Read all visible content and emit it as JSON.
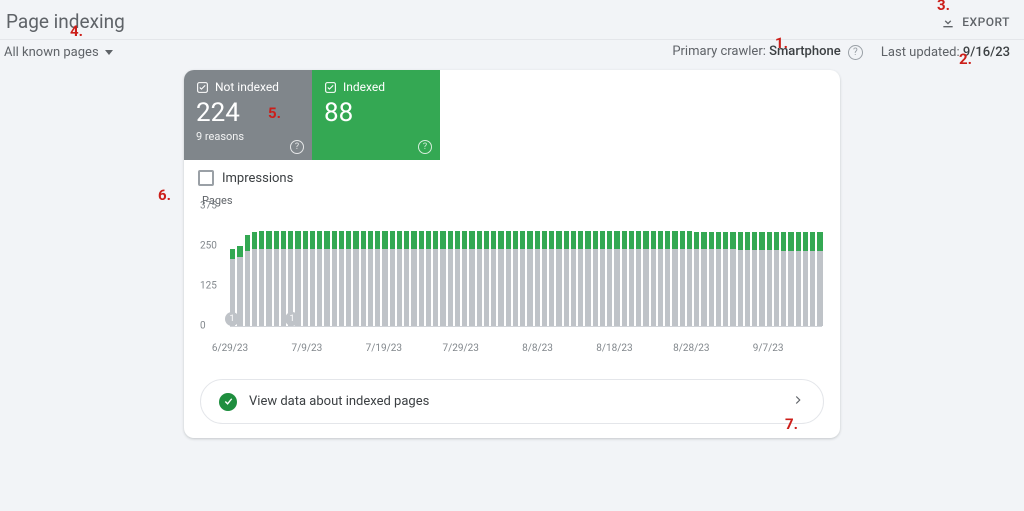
{
  "header": {
    "title": "Page indexing",
    "export_label": "EXPORT"
  },
  "filter": {
    "scope_label": "All known pages",
    "primary_crawler_label": "Primary crawler:",
    "primary_crawler_value": "Smartphone",
    "last_updated_label": "Last updated:",
    "last_updated_value": "9/16/23"
  },
  "status": {
    "not_indexed": {
      "label": "Not indexed",
      "count": "224",
      "subtext": "9 reasons"
    },
    "indexed": {
      "label": "Indexed",
      "count": "88"
    }
  },
  "impressions": {
    "label": "Impressions",
    "checked": false
  },
  "cta": {
    "text": "View data about indexed pages"
  },
  "annotations": [
    "1.",
    "2.",
    "3.",
    "4.",
    "5.",
    "6.",
    "7."
  ],
  "chart_data": {
    "type": "bar",
    "ylabel": "Pages",
    "yticks": [
      0,
      125,
      250,
      375
    ],
    "ylim": [
      0,
      375
    ],
    "x_labels": [
      "6/29/23",
      "7/9/23",
      "7/19/23",
      "7/29/23",
      "8/8/23",
      "8/18/23",
      "8/28/23",
      "9/7/23"
    ],
    "series": [
      {
        "name": "Not indexed",
        "color": "#bfc3c8"
      },
      {
        "name": "Indexed",
        "color": "#34a853"
      }
    ],
    "event_markers": [
      {
        "label": "1",
        "approx_date": "7/1/23"
      },
      {
        "label": "1",
        "approx_date": "7/9/23"
      }
    ],
    "bars": [
      {
        "not_indexed": 210,
        "indexed": 30
      },
      {
        "not_indexed": 215,
        "indexed": 35
      },
      {
        "not_indexed": 235,
        "indexed": 48
      },
      {
        "not_indexed": 240,
        "indexed": 55
      },
      {
        "not_indexed": 240,
        "indexed": 56
      },
      {
        "not_indexed": 240,
        "indexed": 56
      },
      {
        "not_indexed": 240,
        "indexed": 56
      },
      {
        "not_indexed": 240,
        "indexed": 56
      },
      {
        "not_indexed": 240,
        "indexed": 56
      },
      {
        "not_indexed": 240,
        "indexed": 56
      },
      {
        "not_indexed": 240,
        "indexed": 56
      },
      {
        "not_indexed": 240,
        "indexed": 56
      },
      {
        "not_indexed": 240,
        "indexed": 56
      },
      {
        "not_indexed": 240,
        "indexed": 56
      },
      {
        "not_indexed": 240,
        "indexed": 56
      },
      {
        "not_indexed": 240,
        "indexed": 56
      },
      {
        "not_indexed": 240,
        "indexed": 56
      },
      {
        "not_indexed": 240,
        "indexed": 56
      },
      {
        "not_indexed": 240,
        "indexed": 56
      },
      {
        "not_indexed": 240,
        "indexed": 56
      },
      {
        "not_indexed": 240,
        "indexed": 56
      },
      {
        "not_indexed": 240,
        "indexed": 56
      },
      {
        "not_indexed": 240,
        "indexed": 56
      },
      {
        "not_indexed": 240,
        "indexed": 56
      },
      {
        "not_indexed": 240,
        "indexed": 56
      },
      {
        "not_indexed": 240,
        "indexed": 56
      },
      {
        "not_indexed": 240,
        "indexed": 56
      },
      {
        "not_indexed": 240,
        "indexed": 56
      },
      {
        "not_indexed": 240,
        "indexed": 56
      },
      {
        "not_indexed": 240,
        "indexed": 56
      },
      {
        "not_indexed": 240,
        "indexed": 56
      },
      {
        "not_indexed": 240,
        "indexed": 56
      },
      {
        "not_indexed": 240,
        "indexed": 56
      },
      {
        "not_indexed": 240,
        "indexed": 56
      },
      {
        "not_indexed": 240,
        "indexed": 56
      },
      {
        "not_indexed": 240,
        "indexed": 56
      },
      {
        "not_indexed": 240,
        "indexed": 56
      },
      {
        "not_indexed": 240,
        "indexed": 56
      },
      {
        "not_indexed": 240,
        "indexed": 56
      },
      {
        "not_indexed": 240,
        "indexed": 56
      },
      {
        "not_indexed": 240,
        "indexed": 56
      },
      {
        "not_indexed": 240,
        "indexed": 56
      },
      {
        "not_indexed": 240,
        "indexed": 56
      },
      {
        "not_indexed": 240,
        "indexed": 56
      },
      {
        "not_indexed": 240,
        "indexed": 56
      },
      {
        "not_indexed": 240,
        "indexed": 56
      },
      {
        "not_indexed": 240,
        "indexed": 56
      },
      {
        "not_indexed": 240,
        "indexed": 56
      },
      {
        "not_indexed": 240,
        "indexed": 56
      },
      {
        "not_indexed": 240,
        "indexed": 56
      },
      {
        "not_indexed": 240,
        "indexed": 56
      },
      {
        "not_indexed": 240,
        "indexed": 56
      },
      {
        "not_indexed": 240,
        "indexed": 56
      },
      {
        "not_indexed": 240,
        "indexed": 56
      },
      {
        "not_indexed": 240,
        "indexed": 56
      },
      {
        "not_indexed": 240,
        "indexed": 56
      },
      {
        "not_indexed": 240,
        "indexed": 56
      },
      {
        "not_indexed": 240,
        "indexed": 56
      },
      {
        "not_indexed": 240,
        "indexed": 56
      },
      {
        "not_indexed": 240,
        "indexed": 56
      },
      {
        "not_indexed": 240,
        "indexed": 56
      },
      {
        "not_indexed": 240,
        "indexed": 56
      },
      {
        "not_indexed": 240,
        "indexed": 56
      },
      {
        "not_indexed": 240,
        "indexed": 56
      },
      {
        "not_indexed": 240,
        "indexed": 54
      },
      {
        "not_indexed": 240,
        "indexed": 54
      },
      {
        "not_indexed": 240,
        "indexed": 54
      },
      {
        "not_indexed": 240,
        "indexed": 54
      },
      {
        "not_indexed": 240,
        "indexed": 54
      },
      {
        "not_indexed": 240,
        "indexed": 54
      },
      {
        "not_indexed": 238,
        "indexed": 55
      },
      {
        "not_indexed": 238,
        "indexed": 55
      },
      {
        "not_indexed": 238,
        "indexed": 55
      },
      {
        "not_indexed": 238,
        "indexed": 55
      },
      {
        "not_indexed": 238,
        "indexed": 55
      },
      {
        "not_indexed": 238,
        "indexed": 55
      },
      {
        "not_indexed": 235,
        "indexed": 60
      },
      {
        "not_indexed": 235,
        "indexed": 60
      },
      {
        "not_indexed": 235,
        "indexed": 60
      },
      {
        "not_indexed": 235,
        "indexed": 60
      },
      {
        "not_indexed": 235,
        "indexed": 60
      },
      {
        "not_indexed": 235,
        "indexed": 60
      }
    ]
  }
}
